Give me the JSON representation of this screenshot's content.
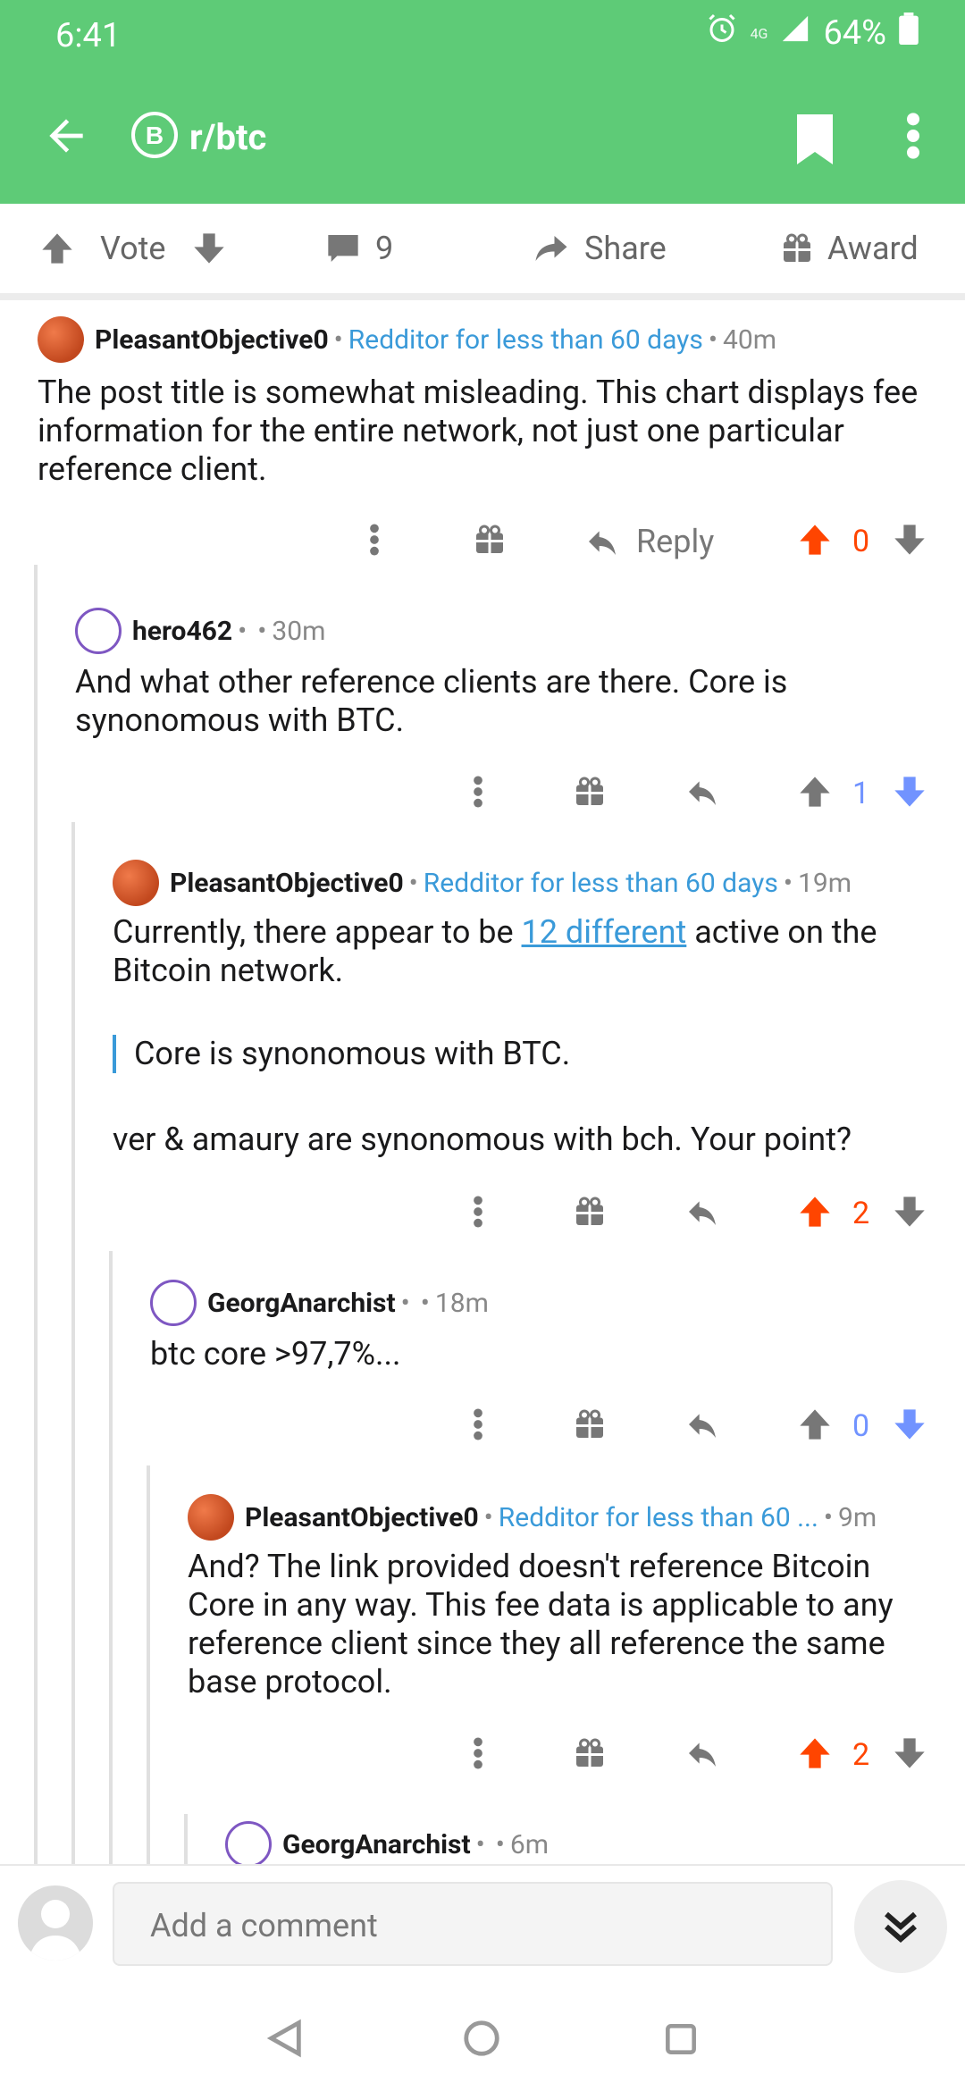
{
  "status": {
    "time": "6:41",
    "network": "4G",
    "battery": "64%"
  },
  "appbar": {
    "subreddit": "r/btc",
    "sub_icon_letter": "B"
  },
  "actions": {
    "vote": "Vote",
    "comments": "9",
    "share": "Share",
    "award": "Award"
  },
  "comments": [
    {
      "user": "PleasantObjective0",
      "flair": "Redditor for less than 60 days",
      "age": "40m",
      "body": "The post title is somewhat misleading. This chart displays fee information for the entire network, not just one particular reference client.",
      "reply": "Reply",
      "score": "0"
    },
    {
      "user": "hero462",
      "age": "30m",
      "body": "And what other reference clients are there.  Core is synonomous with BTC.",
      "score": "1"
    },
    {
      "user": "PleasantObjective0",
      "flair": "Redditor for less than 60 days",
      "age": "19m",
      "body_before_link": "Currently, there appear to be ",
      "link": "12 different",
      "body_after_link": " active on the Bitcoin network.",
      "quote": "Core is synonomous with BTC.",
      "body2": "ver & amaury are synonomous with bch.  Your point?",
      "score": "2"
    },
    {
      "user": "GeorgAnarchist",
      "age": "18m",
      "body": "btc core >97,7%...",
      "score": "0"
    },
    {
      "user": "PleasantObjective0",
      "flair": "Redditor for less than 60 ...",
      "age": "9m",
      "body": "And?  The link provided doesn't reference Bitcoin Core in any way.  This fee data is applicable to any reference client since they all reference the same base protocol.",
      "score": "2"
    },
    {
      "user": "GeorgAnarchist",
      "age": "6m"
    }
  ],
  "composer": {
    "placeholder": "Add a comment"
  },
  "colors": {
    "brand": "#5ecb77",
    "upvote": "#ff4500",
    "downvote": "#7193ff",
    "flair": "#3a9ad9"
  }
}
